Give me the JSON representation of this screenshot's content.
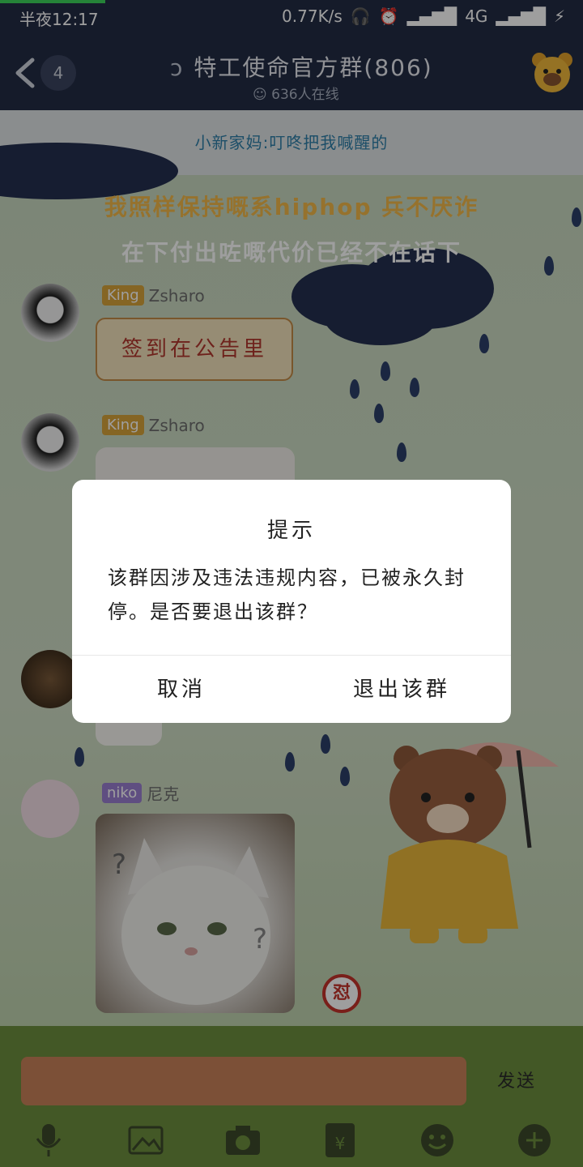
{
  "status_bar": {
    "time": "半夜12:17",
    "net_speed": "0.77K/s",
    "network": "4G"
  },
  "header": {
    "unread_count": "4",
    "title": "特工使命官方群(806)",
    "online": "636人在线"
  },
  "pinned_notice": "小新家妈:叮咚把我喊醒的",
  "background_lyrics": [
    "我照样保持嘅系hiphop 兵不厌诈",
    "在下付出咗嘅代价已经不在话下"
  ],
  "messages": [
    {
      "tag": "King",
      "name": "Zsharo",
      "text": "签到在公告里"
    },
    {
      "tag": "King",
      "name": "Zsharo",
      "text": ""
    },
    {
      "tag": "niko",
      "name": "尼克",
      "text": ""
    }
  ],
  "input": {
    "send_label": "发送"
  },
  "dialog": {
    "title": "提示",
    "message": "该群因涉及违法违规内容，已被永久封停。是否要退出该群？",
    "cancel_label": "取消",
    "confirm_label": "退出该群"
  },
  "icons": [
    "back-arrow-icon",
    "ear-icon",
    "online-icon",
    "voice-icon",
    "image-icon",
    "camera-icon",
    "red-packet-icon",
    "emoji-icon",
    "plus-icon"
  ],
  "colors": {
    "header_bg": "#232c45",
    "notice_text": "#2e7fa8",
    "lyric_yellow": "#f2b94a",
    "tag_king": "#d7a43a",
    "tag_niko": "#9a7fd0"
  }
}
